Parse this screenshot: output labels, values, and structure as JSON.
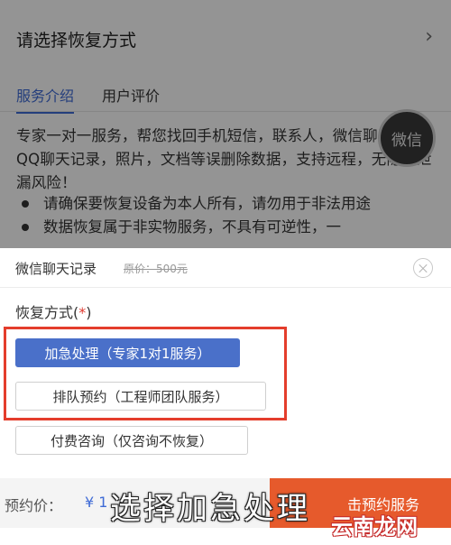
{
  "background": {
    "select_title": "请选择恢复方式",
    "select_chevron": "chevron-right-icon",
    "tabs": [
      {
        "label": "服务介绍",
        "active": true
      },
      {
        "label": "用户评价",
        "active": false
      }
    ],
    "intro": "专家一对一服务，帮您找回手机短信，联系人，微信聊天记录、QQ聊天记录，照片，文档等误删除数据，支持远程，无隐私泄漏风险！",
    "bullets": [
      "请确保要恢复设备为本人所有，请勿用于非法用途",
      "数据恢复属于非实物服务，不具有可逆性，一"
    ],
    "floating_button": "微信"
  },
  "sheet": {
    "title": "微信聊天记录",
    "original_price": "原价：500元",
    "close_icon": "close-circle-icon",
    "method_label": "恢复方式(",
    "method_required": "*",
    "method_label_end": ")",
    "options": [
      {
        "label": "加急处理（专家1对1服务）",
        "selected": true
      },
      {
        "label": "排队预约（工程师团队服务）",
        "selected": false
      },
      {
        "label": "付费咨询（仅咨询不恢复）",
        "selected": false
      }
    ],
    "footer": {
      "deposit_label": "预约价：",
      "deposit_value": "¥ 1",
      "book_button": "击预约服务"
    }
  },
  "overlay_caption": "选择加急处理",
  "watermark": "云南龙网",
  "colors": {
    "accent_blue": "#4a70c9",
    "highlight_red": "#e43d2c",
    "cta_orange": "#e65a2c"
  }
}
